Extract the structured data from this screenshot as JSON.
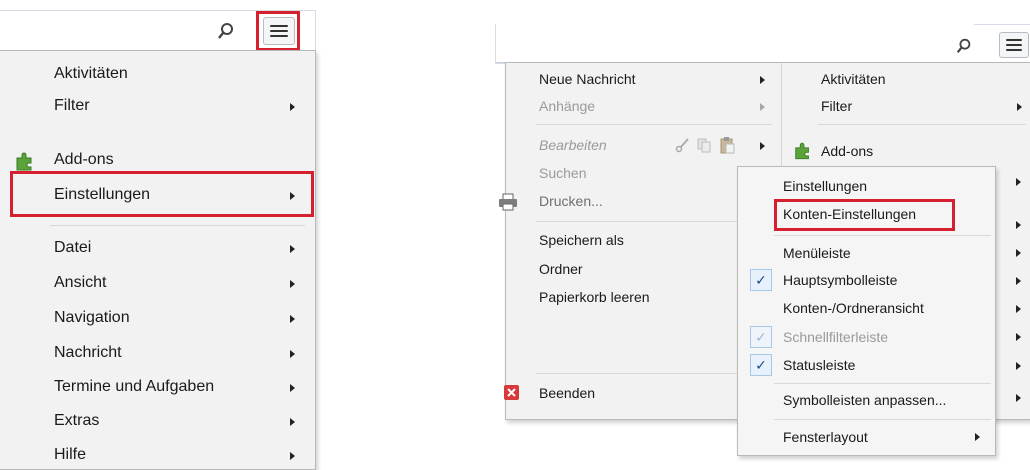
{
  "left": {
    "menu_items": [
      {
        "label": "Aktivitäten",
        "submenu": false
      },
      {
        "label": "Filter",
        "submenu": true
      },
      {
        "label": "Add-ons",
        "submenu": false,
        "icon": "puzzle-icon"
      },
      {
        "label": "Einstellungen",
        "submenu": true,
        "highlighted": true
      },
      {
        "label": "Datei",
        "submenu": true
      },
      {
        "label": "Ansicht",
        "submenu": true
      },
      {
        "label": "Navigation",
        "submenu": true
      },
      {
        "label": "Nachricht",
        "submenu": true
      },
      {
        "label": "Termine und Aufgaben",
        "submenu": true
      },
      {
        "label": "Extras",
        "submenu": true
      },
      {
        "label": "Hilfe",
        "submenu": true
      }
    ]
  },
  "right": {
    "left_menu": [
      {
        "label": "Neue Nachricht",
        "submenu": true
      },
      {
        "label": "Anhänge",
        "submenu": true,
        "disabled": true
      },
      {
        "label": "Bearbeiten",
        "submenu": true,
        "italic": true
      },
      {
        "label": "Suchen",
        "submenu": false,
        "disabled": true
      },
      {
        "label": "Drucken...",
        "submenu": false,
        "icon": "printer-icon"
      },
      {
        "label": "Speichern als",
        "submenu": true
      },
      {
        "label": "Ordner",
        "submenu": true
      },
      {
        "label": "Papierkorb leeren",
        "submenu": false
      },
      {
        "label": "Beenden",
        "submenu": false,
        "icon": "close-red-icon"
      }
    ],
    "right_menu": [
      {
        "label": "Aktivitäten",
        "submenu": false
      },
      {
        "label": "Filter",
        "submenu": true
      },
      {
        "label": "Add-ons",
        "submenu": false,
        "icon": "puzzle-icon"
      }
    ],
    "submenu": [
      {
        "label": "Einstellungen"
      },
      {
        "label": "Konten-Einstellungen",
        "highlighted": true
      },
      {
        "label": "Menüleiste",
        "submenu": true
      },
      {
        "label": "Hauptsymbolleiste",
        "checked": true,
        "submenu": true
      },
      {
        "label": "Konten-/Ordneransicht",
        "submenu": true
      },
      {
        "label": "Schnellfilterleiste",
        "checked": true,
        "disabled": true,
        "submenu": true
      },
      {
        "label": "Statusleiste",
        "checked": true,
        "submenu": true
      },
      {
        "label": "Symbolleisten anpassen...",
        "submenu": true
      },
      {
        "label": "Fensterlayout",
        "submenu": true
      }
    ]
  },
  "colors": {
    "highlight": "#d62030",
    "menu_bg": "#f2f2f2"
  }
}
